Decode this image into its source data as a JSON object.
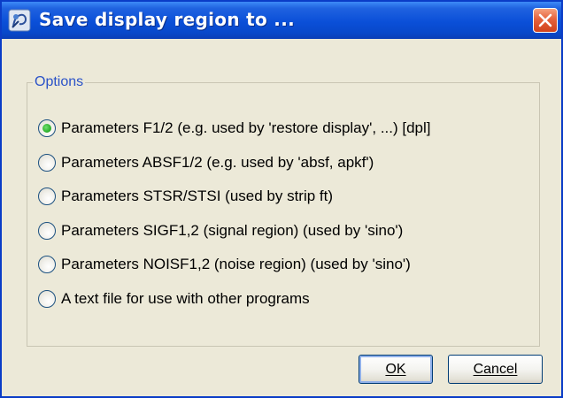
{
  "window": {
    "title": "Save display region to ..."
  },
  "options": {
    "legend": "Options",
    "items": [
      {
        "label": "Parameters F1/2 (e.g. used by 'restore display', ...) [dpl]",
        "selected": true
      },
      {
        "label": "Parameters ABSF1/2 (e.g. used by 'absf, apkf')",
        "selected": false
      },
      {
        "label": "Parameters STSR/STSI (used by strip ft)",
        "selected": false
      },
      {
        "label": "Parameters SIGF1,2 (signal region) (used by 'sino')",
        "selected": false
      },
      {
        "label": "Parameters NOISF1,2 (noise region) (used by 'sino')",
        "selected": false
      },
      {
        "label": "A text file for use with other programs",
        "selected": false
      }
    ]
  },
  "buttons": {
    "ok_label": "OK",
    "cancel_label": "Cancel"
  },
  "icons": {
    "app": "app-icon",
    "close": "close-icon"
  },
  "colors": {
    "titlebar": "#0a4fd8",
    "dialog_bg": "#ece9d8",
    "legend_text": "#2a52c8",
    "close_button": "#e5623c",
    "radio_selected": "#2fb12f"
  }
}
